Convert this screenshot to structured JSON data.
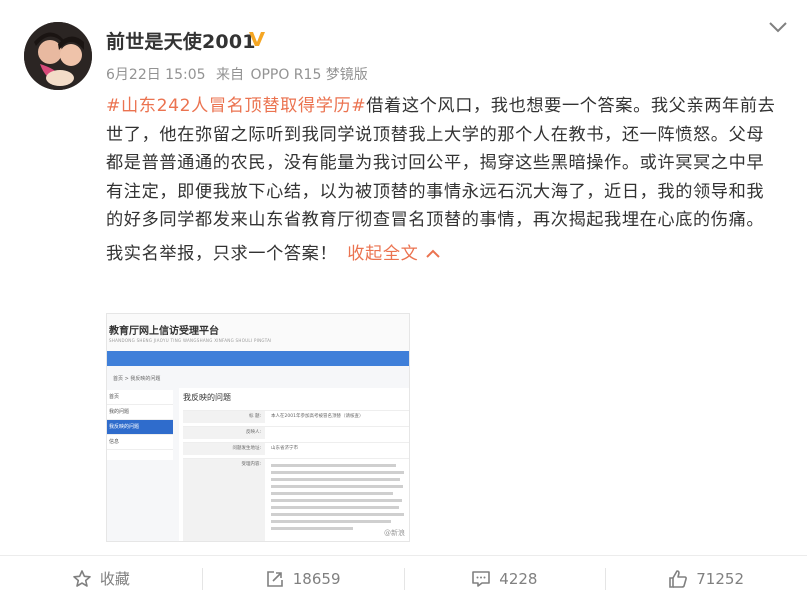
{
  "post": {
    "author": "前世是天使2001",
    "date": "6月22日 15:05",
    "source_prefix": "来自",
    "source": "OPPO R15 梦镜版",
    "hashtag": "#山东242人冒名顶替取得学历#",
    "paragraph1": "借着这个风口，我也想要一个答案。我父亲两年前去世了，他在弥留之际听到我同学说顶替我上大学的那个人在教书，还一阵愤怒。父母都是普普通通的农民，没有能量为我讨回公平，揭穿这些黑暗操作。或许冥冥之中早有注定，即便我放下心结，以为被顶替的事情永远石沉大海了，近日，我的领导和我的好多同学都发来山东省教育厅彻查冒名顶替的事情，再次揭起我埋在心底的伤痛。",
    "paragraph2": "我实名举报，只求一个答案！",
    "collapse_label": "收起全文"
  },
  "image": {
    "header_title": "教育厅网上信访受理平台",
    "header_sub": "SHANDONG SHENG JIAOYU TING WANGSHANG XINFANG SHOULI PINGTAI",
    "breadcrumb": "首页 > 我反映的问题",
    "sidebar": [
      "首页",
      "我的问题",
      "我反映的问题",
      "信息"
    ],
    "panel_title": "我反映的问题",
    "rows": [
      {
        "key": "标 题:",
        "value": "本人在2001年参加高考被冒名顶替（请核查）"
      },
      {
        "key": "反映人:",
        "value": ""
      },
      {
        "key": "问题发生地址:",
        "value": "山东省济宁市"
      },
      {
        "key": "受理内容:",
        "value": "2001年，我参加了高考..."
      }
    ],
    "watermark": "@新浪"
  },
  "actions": {
    "favorite": "收藏",
    "repost": "18659",
    "comment": "4228",
    "like": "71252"
  },
  "colors": {
    "accent": "#eb7350",
    "verified": "#f5a623",
    "muted": "#939393"
  },
  "icons": {
    "more": "chevron-down-icon",
    "verified": "verified-v-icon",
    "favorite": "star-icon",
    "repost": "repost-icon",
    "comment": "comment-icon",
    "like": "thumbs-up-icon"
  }
}
